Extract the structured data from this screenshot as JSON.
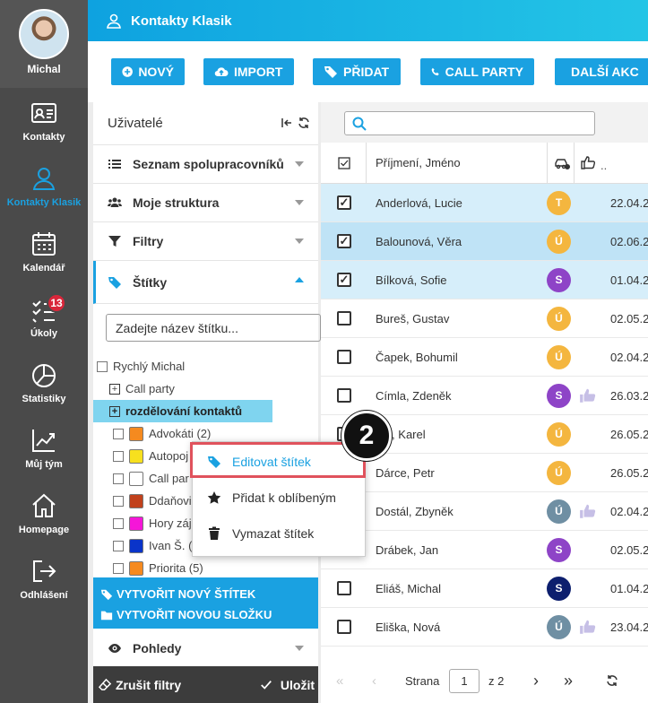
{
  "nav": {
    "user_name": "Michal",
    "items": [
      {
        "label": "Kontakty",
        "icon": "contact-card-icon"
      },
      {
        "label": "Kontakty Klasik",
        "icon": "person-icon",
        "active": true
      },
      {
        "label": "Kalendář",
        "icon": "calendar-icon"
      },
      {
        "label": "Úkoly",
        "icon": "tasks-icon",
        "badge": "13"
      },
      {
        "label": "Statistiky",
        "icon": "pie-chart-icon"
      },
      {
        "label": "Můj tým",
        "icon": "trend-chart-icon"
      },
      {
        "label": "Homepage",
        "icon": "home-icon"
      },
      {
        "label": "Odhlášení",
        "icon": "logout-icon"
      }
    ]
  },
  "header": {
    "title": "Kontakty Klasik"
  },
  "toolbar": {
    "new": "NOVÝ",
    "import": "IMPORT",
    "add": "PŘIDAT",
    "call_party": "CALL PARTY",
    "more": "DALŠÍ AKC"
  },
  "left": {
    "title": "Uživatelé",
    "sections": {
      "coworkers": "Seznam spolupracovníků",
      "structure": "Moje struktura",
      "filters": "Filtry",
      "tags": "Štítky",
      "views": "Pohledy"
    },
    "tag_search_placeholder": "Zadejte název štítku...",
    "tree": {
      "root": "Rychlý Michal",
      "folder1": "Call party",
      "folder2": "rozdělování kontaktů",
      "items": [
        {
          "label": "Advokáti (2)",
          "color": "#f58a1f"
        },
        {
          "label": "Autopoj",
          "color": "#f7e01e"
        },
        {
          "label": "Call par",
          "color": "#ffffff"
        },
        {
          "label": "Ddaňovi",
          "color": "#c1411c"
        },
        {
          "label": "Hory záj",
          "color": "#f516d8"
        },
        {
          "label": "Ivan Š. (",
          "color": "#0a34c9"
        },
        {
          "label": "Priorita (5)",
          "color": "#f58a1f"
        }
      ]
    },
    "create_tag": "VYTVOŘIT NOVÝ ŠTÍTEK",
    "create_folder": "VYTVOŘIT NOVOU SLOŽKU",
    "clear_filters": "Zrušit filtry",
    "save": "Uložit"
  },
  "table": {
    "header_name": "Příjmení, Jméno",
    "rows": [
      {
        "name": "Anderlová, Lucie",
        "badge": "T",
        "color": "#f4b63f",
        "date": "22.04.2",
        "checked": true,
        "thumb": false
      },
      {
        "name": "Balounová, Věra",
        "badge": "Ú",
        "color": "#f4b63f",
        "date": "02.06.2",
        "checked": true,
        "thumb": false
      },
      {
        "name": "Bílková, Sofie",
        "badge": "S",
        "color": "#8e44c7",
        "date": "01.04.2",
        "checked": true,
        "thumb": false
      },
      {
        "name": "Bureš, Gustav",
        "badge": "Ú",
        "color": "#f4b63f",
        "date": "02.05.2",
        "checked": false,
        "thumb": false
      },
      {
        "name": "Čapek, Bohumil",
        "badge": "Ú",
        "color": "#f4b63f",
        "date": "02.04.2",
        "checked": false,
        "thumb": false
      },
      {
        "name": "Címla, Zdeněk",
        "badge": "S",
        "color": "#8e44c7",
        "date": "26.03.2",
        "checked": false,
        "thumb": true
      },
      {
        "name": "rce, Karel",
        "badge": "Ú",
        "color": "#f4b63f",
        "date": "26.05.2",
        "checked": false,
        "thumb": false
      },
      {
        "name": "Dárce, Petr",
        "badge": "Ú",
        "color": "#f4b63f",
        "date": "26.05.2",
        "checked": false,
        "thumb": false
      },
      {
        "name": "Dostál, Zbyněk",
        "badge": "Ú",
        "color": "#6f8fa3",
        "date": "02.04.2",
        "checked": false,
        "thumb": true
      },
      {
        "name": "Drábek, Jan",
        "badge": "S",
        "color": "#8e44c7",
        "date": "02.05.2",
        "checked": false,
        "thumb": false
      },
      {
        "name": "Eliáš, Michal",
        "badge": "S",
        "color": "#0d1f6e",
        "date": "01.04.2",
        "checked": false,
        "thumb": false
      },
      {
        "name": "Eliška, Nová",
        "badge": "Ú",
        "color": "#6f8fa3",
        "date": "23.04.2",
        "checked": false,
        "thumb": true
      }
    ]
  },
  "pager": {
    "label": "Strana",
    "page": "1",
    "of": "z 2"
  },
  "context_menu": {
    "edit": "Editovat štítek",
    "favorite": "Přidat k oblíbeným",
    "delete": "Vymazat štítek"
  },
  "step_number": "2"
}
